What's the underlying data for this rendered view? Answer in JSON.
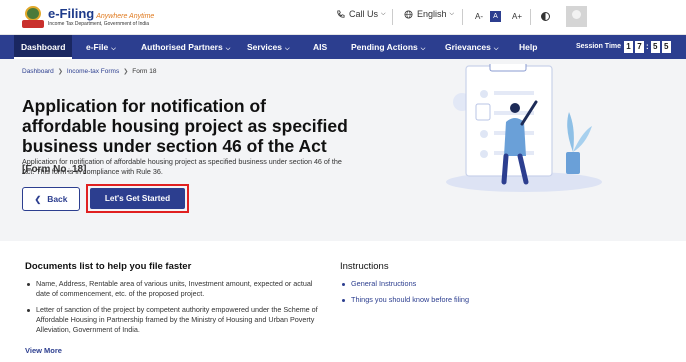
{
  "header": {
    "logo_title": "e-Filing",
    "logo_tagline": "Anywhere Anytime",
    "logo_subtitle": "Income Tax Department, Government of India",
    "call_us": "Call Us",
    "language": "English",
    "font_small": "A-",
    "font_normal": "A",
    "font_large": "A+"
  },
  "nav": {
    "items": [
      {
        "label": "Dashboard"
      },
      {
        "label": "e-File"
      },
      {
        "label": "Authorised Partners"
      },
      {
        "label": "Services"
      },
      {
        "label": "AIS"
      },
      {
        "label": "Pending Actions"
      },
      {
        "label": "Grievances"
      },
      {
        "label": "Help"
      }
    ],
    "session_label": "Session Time",
    "session_digits": [
      "1",
      "7",
      "5",
      "5"
    ]
  },
  "breadcrumb": {
    "items": [
      "Dashboard",
      "Income-tax Forms",
      "Form 18"
    ]
  },
  "page": {
    "title": "Application for notification of affordable housing project as specified business under section 46 of the Act",
    "form_no": "[Form No. 18]",
    "description": "Application for notification of affordable housing project as specified business under section 46 of the Act. This form is in compliance with Rule 36.",
    "back_label": "Back",
    "start_label": "Let's Get Started"
  },
  "documents": {
    "title": "Documents list to help you file faster",
    "items": [
      "Name, Address, Rentable area of various units, Investment amount, expected or actual date of commencement, etc. of the proposed project.",
      "Letter of sanction of the project by competent authority empowered under the Scheme of Affordable Housing in Partnership framed by the Ministry of Housing and Urban Poverty Alleviation, Government of India."
    ],
    "view_more": "View More"
  },
  "instructions": {
    "title": "Instructions",
    "items": [
      "General Instructions",
      "Things you should know before filing"
    ]
  },
  "colors": {
    "primary": "#2c3e8f",
    "highlight": "#e02020",
    "hero_bg": "#f3f4f6"
  }
}
